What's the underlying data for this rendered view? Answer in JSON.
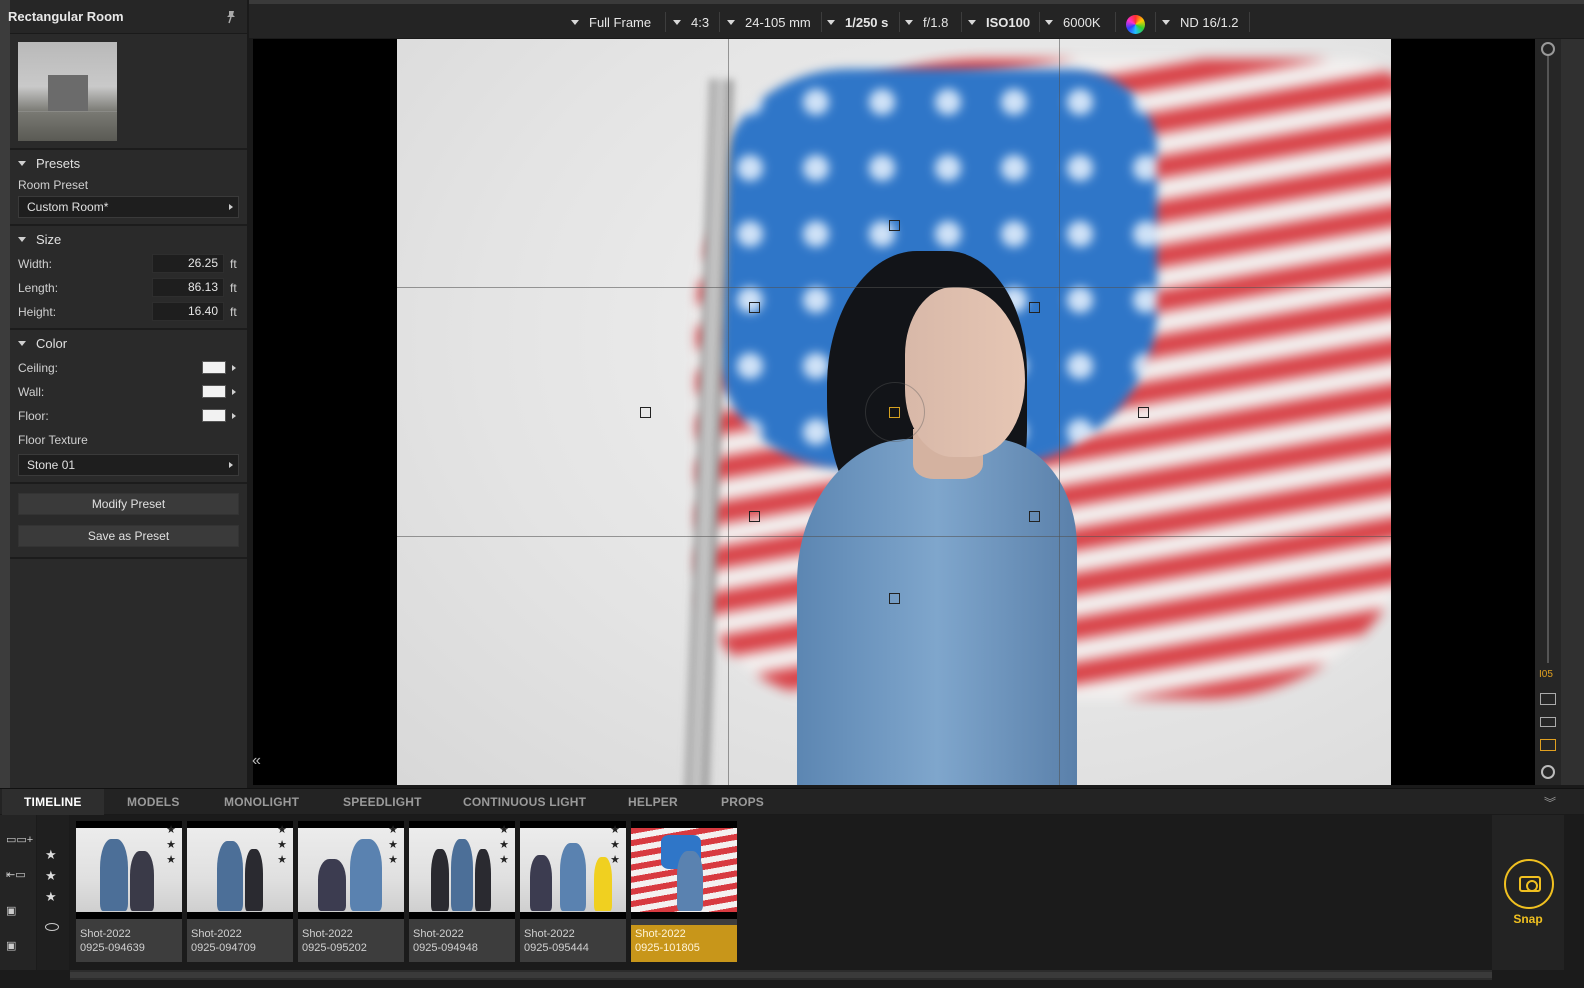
{
  "panel": {
    "title": "Rectangular Room",
    "presets": {
      "heading": "Presets",
      "room_preset_label": "Room Preset",
      "room_preset_value": "Custom Room*"
    },
    "size": {
      "heading": "Size",
      "width_label": "Width:",
      "width_value": "26.25",
      "length_label": "Length:",
      "length_value": "86.13",
      "height_label": "Height:",
      "height_value": "16.40",
      "unit": "ft"
    },
    "color": {
      "heading": "Color",
      "ceiling_label": "Ceiling:",
      "wall_label": "Wall:",
      "floor_label": "Floor:",
      "floor_texture_label": "Floor Texture",
      "floor_texture_value": "Stone 01",
      "swatch_color": "#f2f2f2"
    },
    "modify_preset": "Modify Preset",
    "save_as_preset": "Save as Preset"
  },
  "toolbar": {
    "sensor": "Full Frame",
    "aspect": "4:3",
    "lens": "24-105 mm",
    "shutter": "1/250 s",
    "aperture": "f/1.8",
    "iso": "ISO100",
    "white_balance": "6000K",
    "filter": "ND 16/1.2"
  },
  "right_strip": {
    "badge": "I05"
  },
  "tabs": [
    "TIMELINE",
    "MODELS",
    "MONOLIGHT",
    "SPEEDLIGHT",
    "CONTINUOUS LIGHT",
    "HELPER",
    "PROPS"
  ],
  "shots": [
    {
      "line1": "Shot-2022",
      "line2": "0925-094639"
    },
    {
      "line1": "Shot-2022",
      "line2": "0925-094709"
    },
    {
      "line1": "Shot-2022",
      "line2": "0925-095202"
    },
    {
      "line1": "Shot-2022",
      "line2": "0925-094948"
    },
    {
      "line1": "Shot-2022",
      "line2": "0925-095444"
    },
    {
      "line1": "Shot-2022",
      "line2": "0925-101805"
    }
  ],
  "snap_label": "Snap",
  "accent_color": "#f0c020"
}
